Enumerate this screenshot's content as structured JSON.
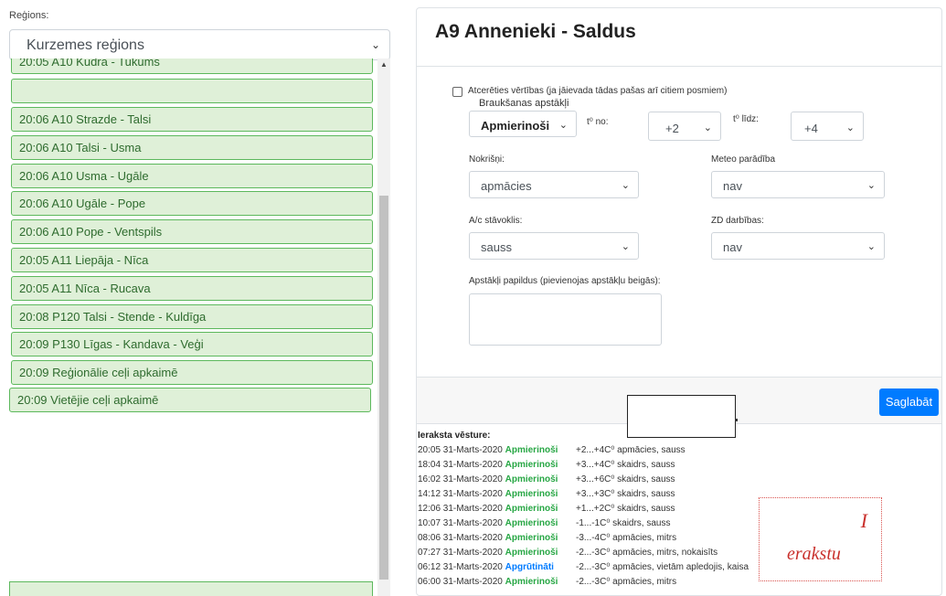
{
  "left": {
    "region_label": "Reģions:",
    "region_value": "Kurzemes reģions",
    "items": [
      "20:05 A10 Kudra - Tukums",
      "",
      "20:06 A10 Strazde - Talsi",
      "20:06 A10 Talsi - Usma",
      "20:06 A10 Usma - Ugāle",
      "20:06 A10 Ugāle - Pope",
      "20:06 A10 Pope - Ventspils",
      "20:05 A11 Liepāja - Nīca",
      "20:05 A11 Nīca - Rucava",
      "20:08 P120 Talsi - Stende - Kuldīga",
      "20:09 P130 Līgas - Kandava - Veģi",
      "20:09 Reģionālie ceļi apkaimē",
      "20:09 Vietējie ceļi apkaimē"
    ]
  },
  "card": {
    "title": "A9 Annenieki - Saldus",
    "remember_label": "Atcerēties vērtības (ja jāievada tādas pašas arī citiem posmiem)",
    "driving_label": "Braukšanas apstākļi",
    "driving_value": "Apmierinoši",
    "t_from_label": "t⁰ no:",
    "t_from_value": "+2",
    "t_to_label": "t⁰ līdz:",
    "t_to_value": "+4",
    "precip_label": "Nokrišņi:",
    "precip_value": "apmācies",
    "meteo_label": "Meteo parādība",
    "meteo_value": "nav",
    "road_label": "A/c stāvoklis:",
    "road_value": "sauss",
    "zd_label": "ZD darbības:",
    "zd_value": "nav",
    "extra_label": "Apstākļi papildus (pievienojas apstākļu beigās):",
    "save_label": "Saglabāt"
  },
  "history": {
    "title": "Ieraksta vēsture:",
    "rows": [
      {
        "time": "20:05 31-Marts-2020",
        "status": "Apmierinoši",
        "detail": "+2...+4C⁰ apmācies, sauss",
        "color": "#28a745"
      },
      {
        "time": "18:04 31-Marts-2020",
        "status": "Apmierinoši",
        "detail": "+3...+4C⁰ skaidrs, sauss",
        "color": "#28a745"
      },
      {
        "time": "16:02 31-Marts-2020",
        "status": "Apmierinoši",
        "detail": "+3...+6C⁰ skaidrs, sauss",
        "color": "#28a745"
      },
      {
        "time": "14:12 31-Marts-2020",
        "status": "Apmierinoši",
        "detail": "+3...+3C⁰ skaidrs, sauss",
        "color": "#28a745"
      },
      {
        "time": "12:06 31-Marts-2020",
        "status": "Apmierinoši",
        "detail": "+1...+2C⁰ skaidrs, sauss",
        "color": "#28a745"
      },
      {
        "time": "10:07 31-Marts-2020",
        "status": "Apmierinoši",
        "detail": "-1...-1C⁰ skaidrs, sauss",
        "color": "#28a745"
      },
      {
        "time": "08:06 31-Marts-2020",
        "status": "Apmierinoši",
        "detail": "-3...-4C⁰ apmācies, mitrs",
        "color": "#28a745"
      },
      {
        "time": "07:27 31-Marts-2020",
        "status": "Apmierinoši",
        "detail": "-2...-3C⁰ apmācies, mitrs, nokaisīts",
        "color": "#28a745"
      },
      {
        "time": "06:12 31-Marts-2020",
        "status": "Apgrūtināti",
        "detail": "-2...-3C⁰ apmācies, vietām apledojis, kaisa",
        "color": "#007bff"
      },
      {
        "time": "06:00 31-Marts-2020",
        "status": "Apmierinoši",
        "detail": "-2...-3C⁰ apmācies, mitrs",
        "color": "#28a745"
      }
    ]
  },
  "annotation": {
    "line1": "I",
    "line2": "erakstu"
  }
}
